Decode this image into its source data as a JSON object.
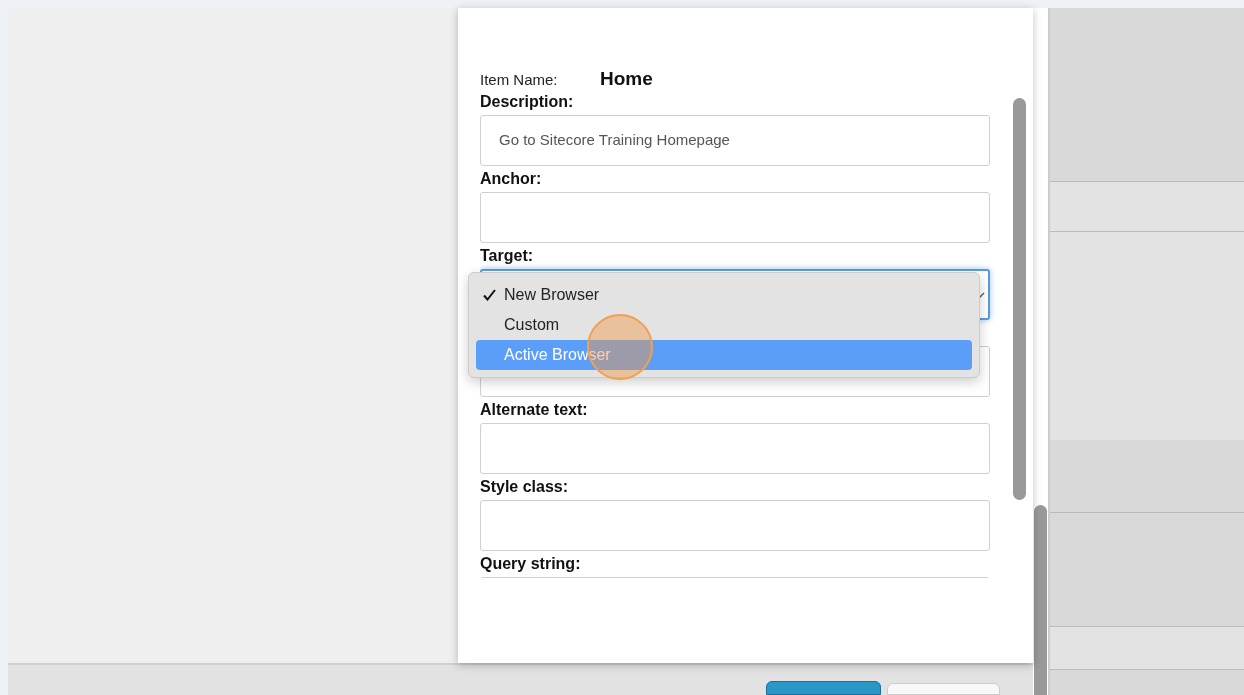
{
  "item_name": {
    "label": "Item Name:",
    "value": "Home"
  },
  "fields": [
    {
      "kind": "text",
      "label": "Description:",
      "value": "Go to Sitecore Training Homepage"
    },
    {
      "kind": "text",
      "label": "Anchor:"
    },
    {
      "kind": "select",
      "label": "Target:",
      "focused": true
    },
    {
      "kind": "text"
    },
    {
      "kind": "text",
      "label": "Alternate text:"
    },
    {
      "kind": "text",
      "label": "Style class:"
    },
    {
      "kind": "text",
      "label": "Query string:"
    }
  ],
  "dropdown": {
    "options": [
      {
        "label": "New Browser",
        "checked": true,
        "selected": false
      },
      {
        "label": "Custom",
        "checked": false,
        "selected": false
      },
      {
        "label": "Active Browser",
        "checked": false,
        "selected": true
      }
    ]
  },
  "click_marker": true
}
